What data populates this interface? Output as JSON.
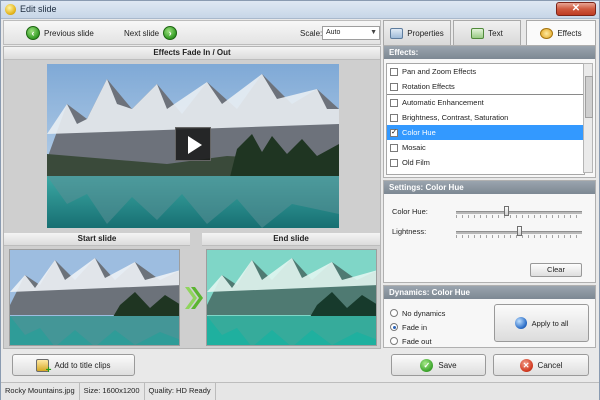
{
  "window": {
    "title": "Edit slide",
    "close_label": "✕"
  },
  "toolbar": {
    "prev_label": "Previous slide",
    "next_label": "Next slide",
    "scale_label": "Scale:",
    "scale_value": "Auto"
  },
  "preview": {
    "header": "Effects Fade In / Out",
    "start_label": "Start slide",
    "end_label": "End slide"
  },
  "tabs": [
    {
      "label": "Properties",
      "icon": "properties-icon",
      "active": false
    },
    {
      "label": "Text",
      "icon": "text-icon",
      "active": false
    },
    {
      "label": "Effects",
      "icon": "effects-icon",
      "active": true
    }
  ],
  "effects": {
    "header": "Effects:",
    "items": [
      {
        "label": "Pan and Zoom Effects",
        "checked": false,
        "selected": false,
        "separator": false
      },
      {
        "label": "Rotation Effects",
        "checked": false,
        "selected": false,
        "separator": false
      },
      {
        "label": "Automatic Enhancement",
        "checked": false,
        "selected": false,
        "separator": true
      },
      {
        "label": "Brightness, Contrast, Saturation",
        "checked": false,
        "selected": false,
        "separator": false
      },
      {
        "label": "Color Hue",
        "checked": true,
        "selected": true,
        "separator": false
      },
      {
        "label": "Mosaic",
        "checked": false,
        "selected": false,
        "separator": false
      },
      {
        "label": "Old Film",
        "checked": false,
        "selected": false,
        "separator": false
      }
    ]
  },
  "settings": {
    "header": "Settings: Color Hue",
    "color_hue_label": "Color Hue:",
    "color_hue_value": 0.4,
    "lightness_label": "Lightness:",
    "lightness_value": 0.5,
    "clear_label": "Clear"
  },
  "dynamics": {
    "header": "Dynamics: Color Hue",
    "options": [
      {
        "label": "No dynamics",
        "selected": false
      },
      {
        "label": "Fade in",
        "selected": true
      },
      {
        "label": "Fade out",
        "selected": false
      }
    ],
    "apply_label": "Apply to all"
  },
  "buttons": {
    "add_title_clips": "Add to title clips",
    "save": "Save",
    "cancel": "Cancel"
  },
  "status": {
    "filename": "Rocky Mountains.jpg",
    "size": "Size: 1600x1200",
    "quality": "Quality: HD Ready"
  },
  "colors": {
    "accent": "#3399ff",
    "header_gray": "#8a949e",
    "go_green": "#3aa12a",
    "cancel_red": "#d23b22"
  }
}
